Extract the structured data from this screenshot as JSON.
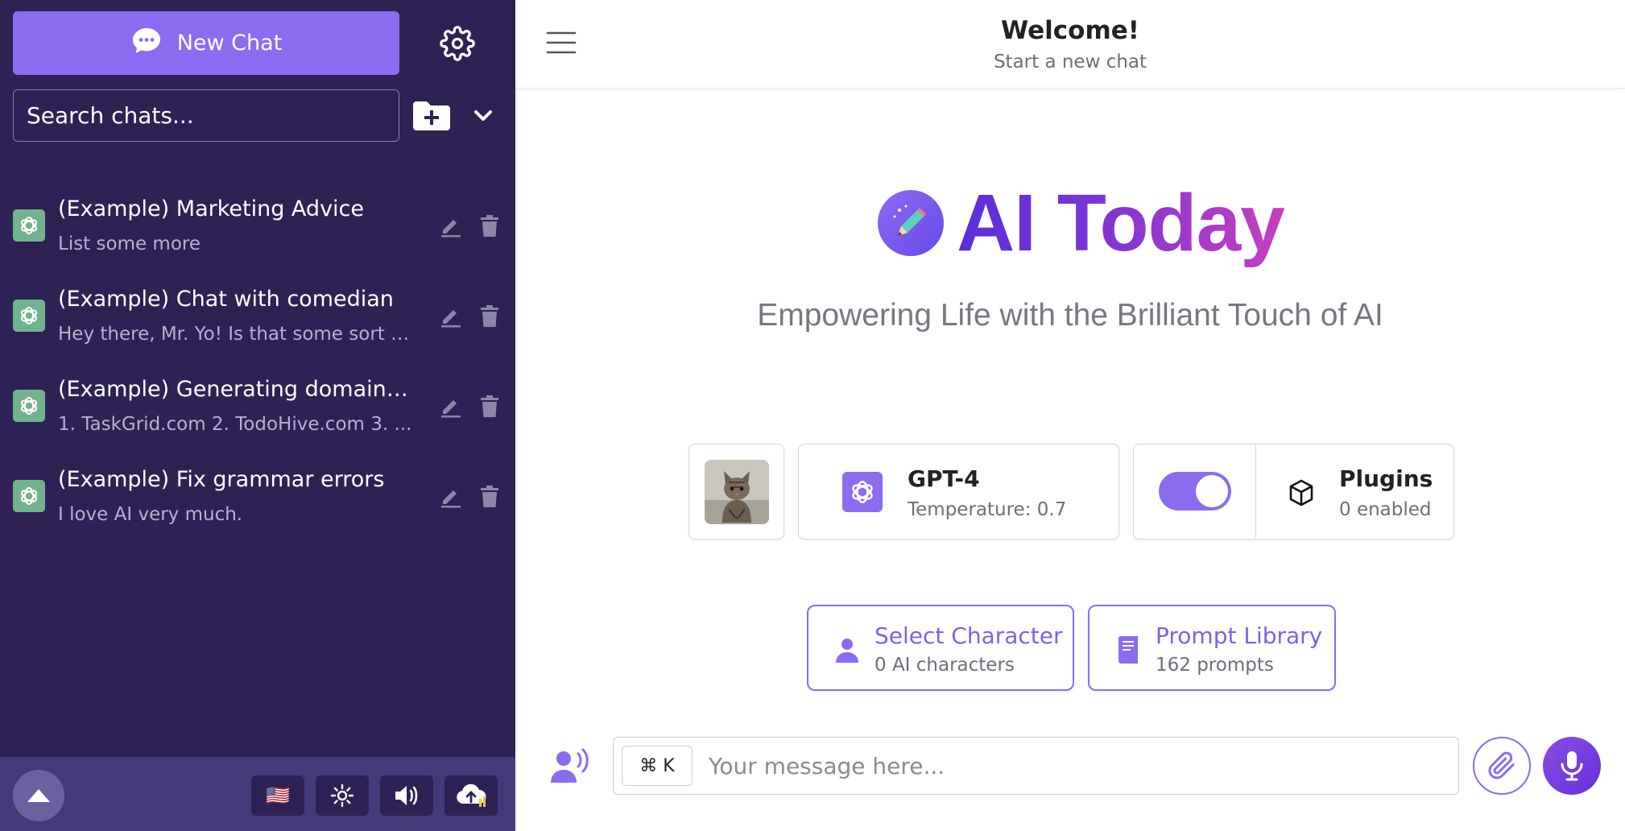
{
  "sidebar": {
    "new_chat_label": "New Chat",
    "search_placeholder": "Search chats...",
    "chats": [
      {
        "title": "(Example) Marketing Advice",
        "preview": "List some more"
      },
      {
        "title": "(Example) Chat with comedian",
        "preview": "Hey there, Mr. Yo! Is that some sort o..."
      },
      {
        "title": "(Example) Generating domain ...",
        "preview": "1. TaskGrid.com 2. TodoHive.com 3. ..."
      },
      {
        "title": "(Example) Fix grammar errors",
        "preview": "I love AI very much."
      }
    ],
    "footer": {
      "language_flag": "🇺🇸"
    }
  },
  "header": {
    "title": "Welcome!",
    "subtitle": "Start a new chat"
  },
  "hero": {
    "brand": "AI Today",
    "tagline": "Empowering Life with the Brilliant Touch of AI"
  },
  "model": {
    "name": "GPT-4",
    "temperature": "Temperature: 0.7"
  },
  "plugins": {
    "label": "Plugins",
    "count": "0 enabled",
    "toggle_on": true
  },
  "character": {
    "title": "Select Character",
    "count": "0 AI characters"
  },
  "prompt_library": {
    "title": "Prompt Library",
    "count": "162 prompts"
  },
  "composer": {
    "shortcut": "⌘ K",
    "placeholder": "Your message here..."
  },
  "colors": {
    "accent": "#8b6cf0",
    "sidebar_bg": "#2e2254",
    "sidebar_footer_bg": "#443a78",
    "chat_icon_bg": "#73b28f"
  }
}
